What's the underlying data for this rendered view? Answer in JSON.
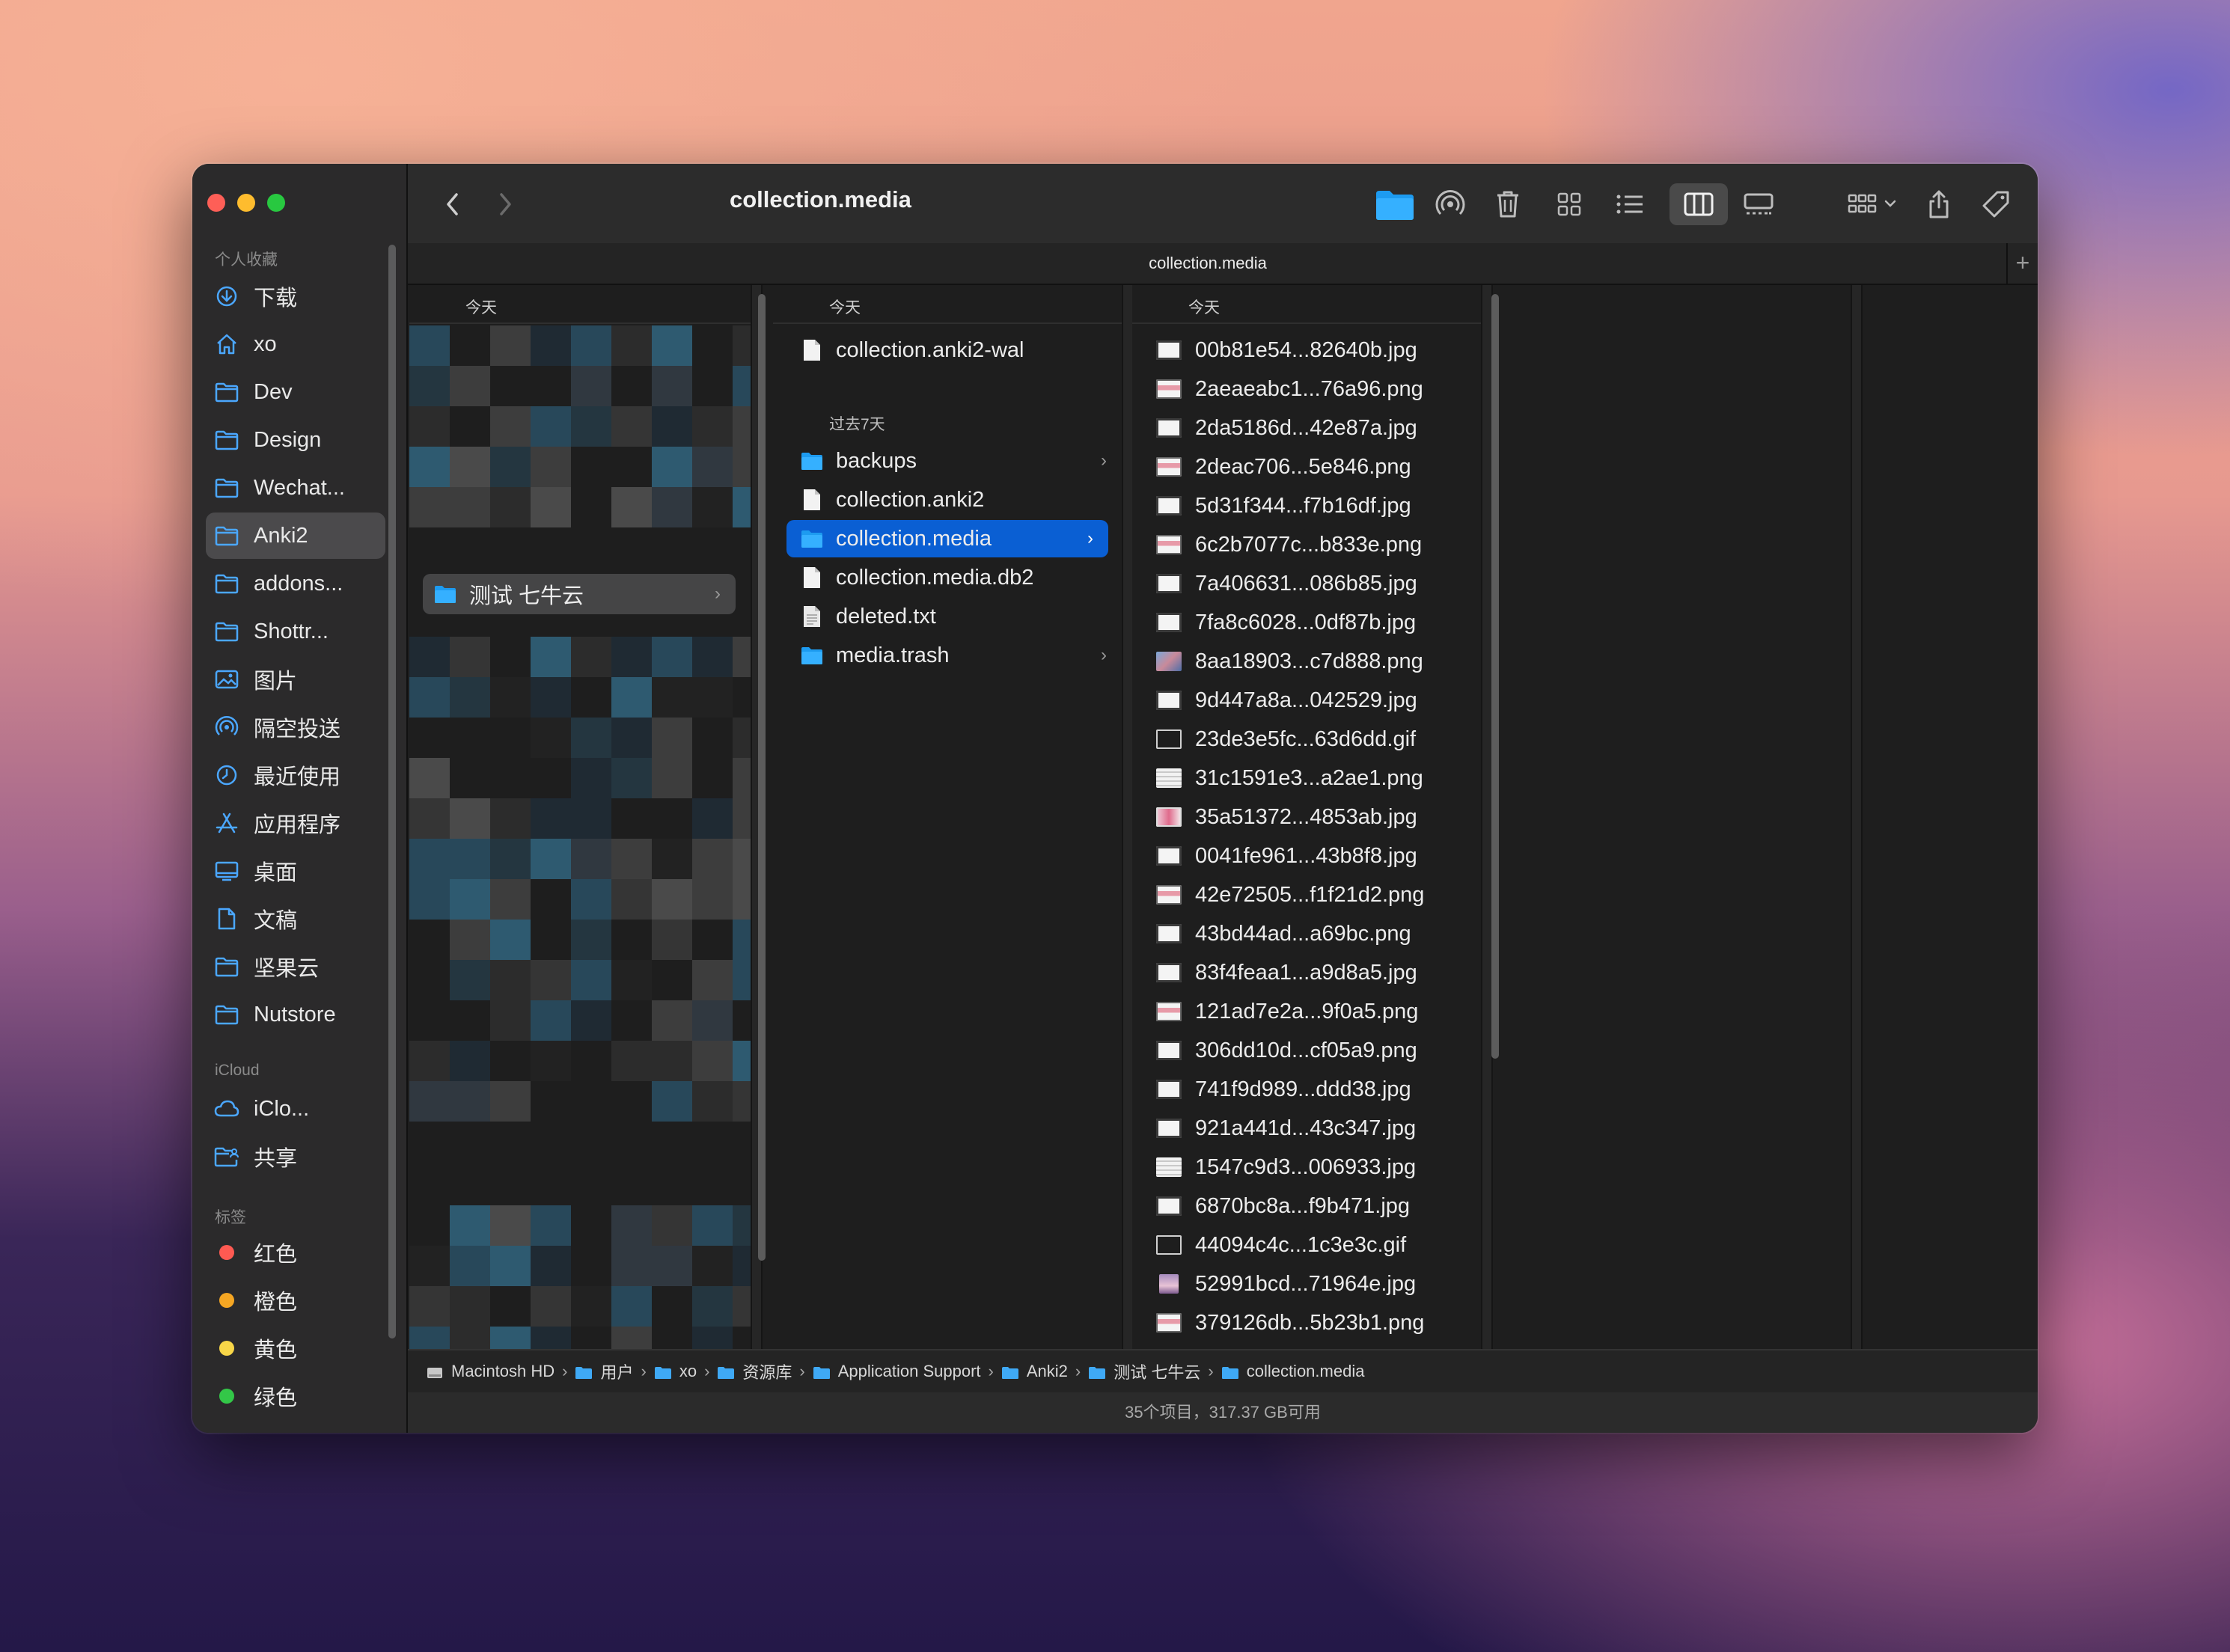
{
  "window": {
    "title": "collection.media",
    "tab_title": "collection.media",
    "tab_add": "+"
  },
  "toolbar": {
    "back_icon": "chevron-left-icon",
    "forward_icon": "chevron-right-icon",
    "view_mode_selected": "columns"
  },
  "sidebar": {
    "favorites_label": "个人收藏",
    "favorites": [
      {
        "label": "下载",
        "icon": "download-icon"
      },
      {
        "label": "xo",
        "icon": "home-icon"
      },
      {
        "label": "Dev",
        "icon": "folder-icon"
      },
      {
        "label": "Design",
        "icon": "folder-icon"
      },
      {
        "label": "Wechat...",
        "icon": "folder-icon"
      },
      {
        "label": "Anki2",
        "icon": "folder-icon",
        "selected": true
      },
      {
        "label": "addons...",
        "icon": "folder-icon"
      },
      {
        "label": "Shottr...",
        "icon": "folder-icon"
      },
      {
        "label": "图片",
        "icon": "photo-icon"
      },
      {
        "label": "隔空投送",
        "icon": "airdrop-icon"
      },
      {
        "label": "最近使用",
        "icon": "clock-icon"
      },
      {
        "label": "应用程序",
        "icon": "apps-icon"
      },
      {
        "label": "桌面",
        "icon": "desktop-icon"
      },
      {
        "label": "文稿",
        "icon": "document-icon"
      },
      {
        "label": "坚果云",
        "icon": "folder-icon"
      },
      {
        "label": "Nutstore",
        "icon": "folder-icon"
      }
    ],
    "icloud_label": "iCloud",
    "icloud": [
      {
        "label": "iClo...",
        "icon": "cloud-icon"
      },
      {
        "label": "共享",
        "icon": "shared-folder-icon"
      }
    ],
    "tags_label": "标签",
    "tags": [
      {
        "label": "红色",
        "color": "#ff5a52"
      },
      {
        "label": "橙色",
        "color": "#f5a623"
      },
      {
        "label": "黄色",
        "color": "#f8d648"
      },
      {
        "label": "绿色",
        "color": "#33c748"
      }
    ]
  },
  "columns": {
    "col1": {
      "header": "今天",
      "selected_folder": "测试 七牛云"
    },
    "col2": {
      "header": "今天",
      "today_items": [
        {
          "label": "collection.anki2-wal",
          "type": "file"
        }
      ],
      "past7_label": "过去7天",
      "past7_items": [
        {
          "label": "backups",
          "type": "folder",
          "chevron": true
        },
        {
          "label": "collection.anki2",
          "type": "file"
        },
        {
          "label": "collection.media",
          "type": "folder",
          "chevron": true,
          "selected": true
        },
        {
          "label": "collection.media.db2",
          "type": "file"
        },
        {
          "label": "deleted.txt",
          "type": "text"
        },
        {
          "label": "media.trash",
          "type": "folder",
          "chevron": true
        }
      ]
    },
    "col3": {
      "header": "今天",
      "files": [
        {
          "name": "00b81e54...82640b.jpg",
          "thumb": "white"
        },
        {
          "name": "2aeaeabc1...76a96.png",
          "thumb": "pinkbar"
        },
        {
          "name": "2da5186d...42e87a.jpg",
          "thumb": "white"
        },
        {
          "name": "2deac706...5e846.png",
          "thumb": "pinkbar"
        },
        {
          "name": "5d31f344...f7b16df.jpg",
          "thumb": "white"
        },
        {
          "name": "6c2b7077c...b833e.png",
          "thumb": "pinkbar"
        },
        {
          "name": "7a406631...086b85.jpg",
          "thumb": "white"
        },
        {
          "name": "7fa8c6028...0df87b.jpg",
          "thumb": "white"
        },
        {
          "name": "8aa18903...c7d888.png",
          "thumb": "photo"
        },
        {
          "name": "9d447a8a...042529.jpg",
          "thumb": "white"
        },
        {
          "name": "23de3e5fc...63d6dd.gif",
          "thumb": "dark"
        },
        {
          "name": "31c1591e3...a2ae1.png",
          "thumb": "lines"
        },
        {
          "name": "35a51372...4853ab.jpg",
          "thumb": "pinkphoto"
        },
        {
          "name": "0041fe961...43b8f8.jpg",
          "thumb": "white"
        },
        {
          "name": "42e72505...f1f21d2.png",
          "thumb": "pinkbar"
        },
        {
          "name": "43bd44ad...a69bc.png",
          "thumb": "white"
        },
        {
          "name": "83f4feaa1...a9d8a5.jpg",
          "thumb": "white"
        },
        {
          "name": "121ad7e2a...9f0a5.png",
          "thumb": "pinkbar"
        },
        {
          "name": "306dd10d...cf05a9.png",
          "thumb": "white"
        },
        {
          "name": "741f9d989...ddd38.jpg",
          "thumb": "white"
        },
        {
          "name": "921a441d...43c347.jpg",
          "thumb": "white"
        },
        {
          "name": "1547c9d3...006933.jpg",
          "thumb": "lines"
        },
        {
          "name": "6870bc8a...f9b471.jpg",
          "thumb": "white"
        },
        {
          "name": "44094c4c...1c3e3c.gif",
          "thumb": "dark"
        },
        {
          "name": "52991bcd...71964e.jpg",
          "thumb": "portrait"
        },
        {
          "name": "379126db...5b23b1.png",
          "thumb": "pinkbar"
        }
      ]
    }
  },
  "pathbar": [
    {
      "label": "Macintosh HD",
      "icon": "disk-icon"
    },
    {
      "label": "用户",
      "icon": "folder-icon"
    },
    {
      "label": "xo",
      "icon": "folder-icon"
    },
    {
      "label": "资源库",
      "icon": "folder-icon"
    },
    {
      "label": "Application Support",
      "icon": "folder-icon"
    },
    {
      "label": "Anki2",
      "icon": "folder-icon"
    },
    {
      "label": "测试 七牛云",
      "icon": "folder-icon"
    },
    {
      "label": "collection.media",
      "icon": "folder-icon"
    }
  ],
  "status": "35个项目，317.37 GB可用"
}
